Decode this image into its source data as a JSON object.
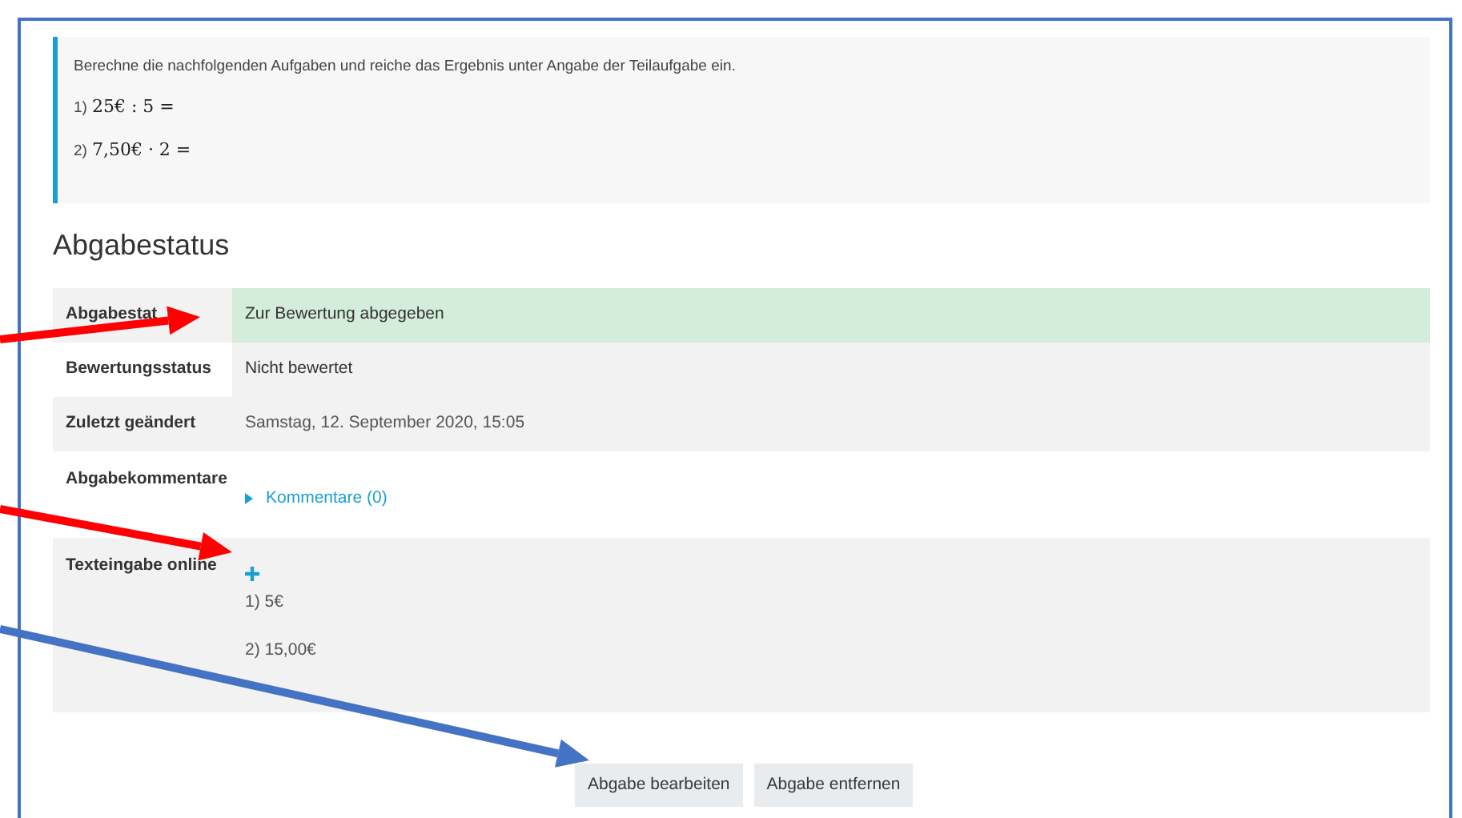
{
  "intro": {
    "text": "Berechne die nachfolgenden Aufgaben und reiche das Ergebnis unter Angabe der Teilaufgabe ein.",
    "tasks": [
      {
        "number": "1)",
        "formula": "25€ : 5 ="
      },
      {
        "number": "2)",
        "formula": "7,50€ · 2 ="
      }
    ]
  },
  "heading": "Abgabestatus",
  "rows": [
    {
      "kind": "status",
      "label": "Abgabestat",
      "value": "Zur Bewertung abgegeben"
    },
    {
      "kind": "plain",
      "label": "Bewertungsstatus",
      "value": "Nicht bewertet"
    },
    {
      "kind": "plain",
      "label": "Zuletzt geändert",
      "value": "Samstag, 12. September 2020, 15:05"
    },
    {
      "kind": "comments",
      "label": "Abgabekommentare",
      "value": "Kommentare (0)"
    },
    {
      "kind": "onlinetext",
      "label": "Texteingabe online",
      "lines": [
        "1) 5€",
        "2) 15,00€"
      ]
    }
  ],
  "buttons": [
    "Abgabe bearbeiten",
    "Abgabe entfernen"
  ],
  "arrows": [
    {
      "color": "#ff0000"
    },
    {
      "color": "#ff0000"
    },
    {
      "color": "#4472c4"
    }
  ]
}
